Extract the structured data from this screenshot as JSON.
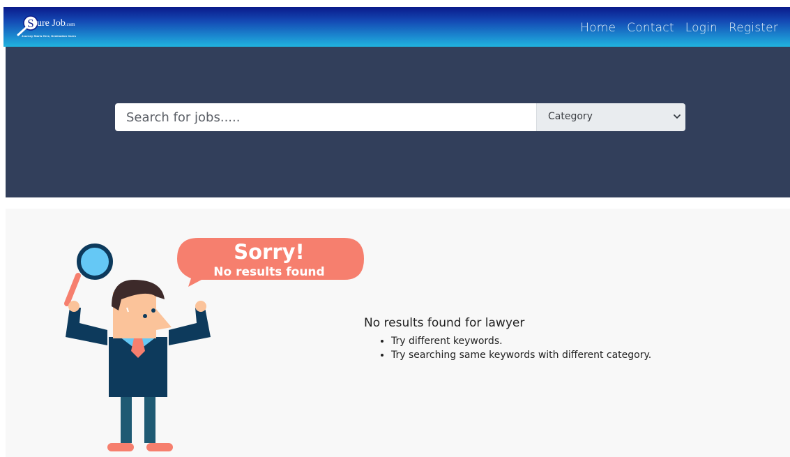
{
  "brand": {
    "logo_letter": "S",
    "name": "ure Job",
    "suffix": ".com",
    "tagline": "Journey Starts Here, Destination Cares"
  },
  "nav": {
    "items": [
      {
        "label": "Home"
      },
      {
        "label": "Contact"
      },
      {
        "label": "Login"
      },
      {
        "label": "Register"
      }
    ]
  },
  "search": {
    "placeholder": "Search for jobs.....",
    "category_selected": "Category"
  },
  "results": {
    "bubble_line1": "Sorry!",
    "bubble_line2": "No results found",
    "title": "No results found for lawyer",
    "tips": [
      "Try different keywords.",
      "Try searching same keywords with different category."
    ]
  },
  "colors": {
    "hero_bg": "#323f5b",
    "results_bg": "#f8f8f8",
    "bubble": "#f67f6e",
    "suit": "#0d3a5c",
    "lens": "#65c8f5"
  },
  "icons": {
    "logo": "magnifier-logo-icon",
    "select": "chevron-down-icon",
    "illustration": "magnifying-glass-icon"
  }
}
